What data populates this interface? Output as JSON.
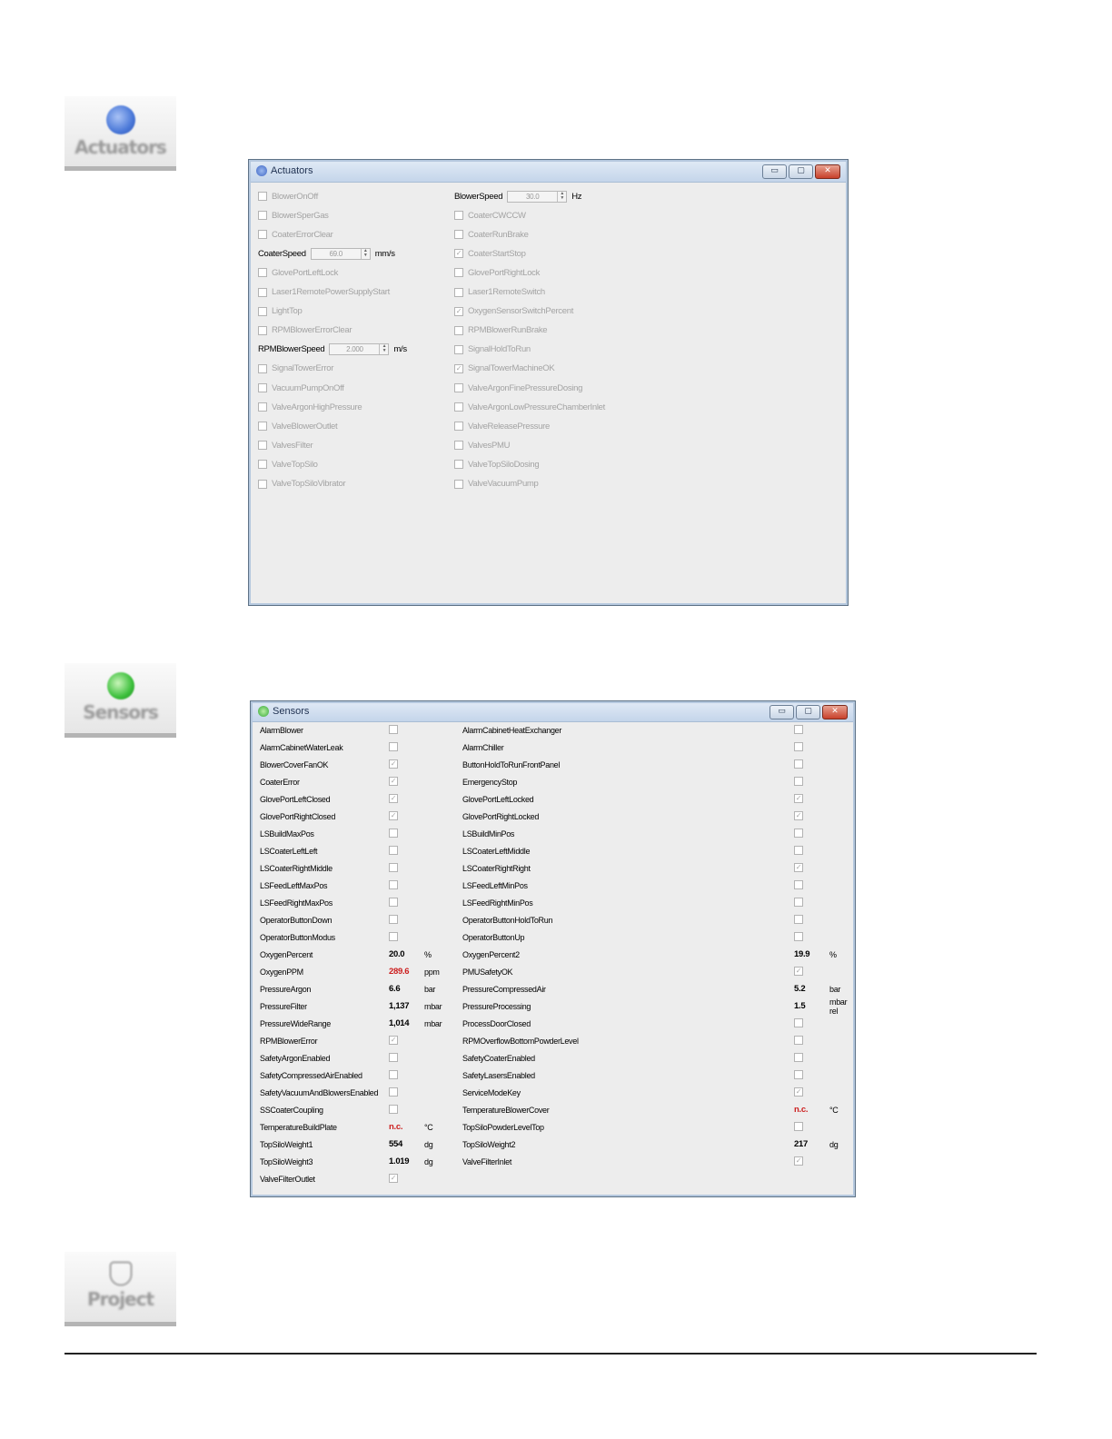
{
  "buttons": {
    "actuators": {
      "label": "Actuators",
      "icon": "gear-blue-icon",
      "color": "#4a78d8"
    },
    "sensors": {
      "label": "Sensors",
      "icon": "sensor-green-icon",
      "color": "#3cbf3c"
    },
    "project": {
      "label": "Project",
      "icon": "shield-outline-icon"
    }
  },
  "actuators_window": {
    "title": "Actuators",
    "left": [
      {
        "type": "check",
        "label": "BlowerOnOff",
        "checked": false
      },
      {
        "type": "check",
        "label": "BlowerSperGas",
        "checked": false
      },
      {
        "type": "check",
        "label": "CoaterErrorClear",
        "checked": false
      },
      {
        "type": "spin",
        "label": "CoaterSpeed",
        "value": "69.0",
        "unit": "mm/s"
      },
      {
        "type": "check",
        "label": "GlovePortLeftLock",
        "checked": false
      },
      {
        "type": "check",
        "label": "Laser1RemotePowerSupplyStart",
        "checked": false
      },
      {
        "type": "check",
        "label": "LightTop",
        "checked": false
      },
      {
        "type": "check",
        "label": "RPMBlowerErrorClear",
        "checked": false
      },
      {
        "type": "spin",
        "label": "RPMBlowerSpeed",
        "value": "2.000",
        "unit": "m/s"
      },
      {
        "type": "check",
        "label": "SignalTowerError",
        "checked": false
      },
      {
        "type": "check",
        "label": "VacuumPumpOnOff",
        "checked": false
      },
      {
        "type": "check",
        "label": "ValveArgonHighPressure",
        "checked": false
      },
      {
        "type": "check",
        "label": "ValveBlowerOutlet",
        "checked": false
      },
      {
        "type": "check",
        "label": "ValvesFilter",
        "checked": false
      },
      {
        "type": "check",
        "label": "ValveTopSilo",
        "checked": false
      },
      {
        "type": "check",
        "label": "ValveTopSiloVibrator",
        "checked": false
      }
    ],
    "right": [
      {
        "type": "spin",
        "label": "BlowerSpeed",
        "value": "30.0",
        "unit": "Hz"
      },
      {
        "type": "check",
        "label": "CoaterCWCCW",
        "checked": false
      },
      {
        "type": "check",
        "label": "CoaterRunBrake",
        "checked": false
      },
      {
        "type": "check",
        "label": "CoaterStartStop",
        "checked": true
      },
      {
        "type": "check",
        "label": "GlovePortRightLock",
        "checked": false
      },
      {
        "type": "check",
        "label": "Laser1RemoteSwitch",
        "checked": false
      },
      {
        "type": "check",
        "label": "OxygenSensorSwitchPercent",
        "checked": true
      },
      {
        "type": "check",
        "label": "RPMBlowerRunBrake",
        "checked": false
      },
      {
        "type": "check",
        "label": "SignalHoldToRun",
        "checked": false
      },
      {
        "type": "check",
        "label": "SignalTowerMachineOK",
        "checked": true
      },
      {
        "type": "check",
        "label": "ValveArgonFinePressureDosing",
        "checked": false
      },
      {
        "type": "check",
        "label": "ValveArgonLowPressureChamberInlet",
        "checked": false
      },
      {
        "type": "check",
        "label": "ValveReleasePressure",
        "checked": false
      },
      {
        "type": "check",
        "label": "ValvesPMU",
        "checked": false
      },
      {
        "type": "check",
        "label": "ValveTopSiloDosing",
        "checked": false
      },
      {
        "type": "check",
        "label": "ValveVacuumPump",
        "checked": false
      }
    ]
  },
  "sensors_window": {
    "title": "Sensors",
    "left": [
      {
        "label": "AlarmBlower",
        "type": "check",
        "checked": false
      },
      {
        "label": "AlarmCabinetWaterLeak",
        "type": "check",
        "checked": false
      },
      {
        "label": "BlowerCoverFanOK",
        "type": "check",
        "checked": true
      },
      {
        "label": "CoaterError",
        "type": "check",
        "checked": true
      },
      {
        "label": "GlovePortLeftClosed",
        "type": "check",
        "checked": true
      },
      {
        "label": "GlovePortRightClosed",
        "type": "check",
        "checked": true
      },
      {
        "label": "LSBuildMaxPos",
        "type": "check",
        "checked": false
      },
      {
        "label": "LSCoaterLeftLeft",
        "type": "check",
        "checked": false
      },
      {
        "label": "LSCoaterRightMiddle",
        "type": "check",
        "checked": false
      },
      {
        "label": "LSFeedLeftMaxPos",
        "type": "check",
        "checked": false
      },
      {
        "label": "LSFeedRightMaxPos",
        "type": "check",
        "checked": false
      },
      {
        "label": "OperatorButtonDown",
        "type": "check",
        "checked": false
      },
      {
        "label": "OperatorButtonModus",
        "type": "check",
        "checked": false
      },
      {
        "label": "OxygenPercent",
        "type": "value",
        "value": "20.0",
        "unit": "%"
      },
      {
        "label": "OxygenPPM",
        "type": "value",
        "value": "289.6",
        "unit": "ppm",
        "alert": true
      },
      {
        "label": "PressureArgon",
        "type": "value",
        "value": "6.6",
        "unit": "bar"
      },
      {
        "label": "PressureFilter",
        "type": "value",
        "value": "1,137",
        "unit": "mbar"
      },
      {
        "label": "PressureWideRange",
        "type": "value",
        "value": "1,014",
        "unit": "mbar"
      },
      {
        "label": "RPMBlowerError",
        "type": "check",
        "checked": true
      },
      {
        "label": "SafetyArgonEnabled",
        "type": "check",
        "checked": false
      },
      {
        "label": "SafetyCompressedAirEnabled",
        "type": "check",
        "checked": false
      },
      {
        "label": "SafetyVacuumAndBlowersEnabled",
        "type": "check",
        "checked": false
      },
      {
        "label": "SSCoaterCoupling",
        "type": "check",
        "checked": false
      },
      {
        "label": "TemperatureBuildPlate",
        "type": "value",
        "value": "n.c.",
        "unit": "°C",
        "alert": true
      },
      {
        "label": "TopSiloWeight1",
        "type": "value",
        "value": "554",
        "unit": "dg"
      },
      {
        "label": "TopSiloWeight3",
        "type": "value",
        "value": "1.019",
        "unit": "dg"
      },
      {
        "label": "ValveFilterOutlet",
        "type": "check",
        "checked": true
      }
    ],
    "right": [
      {
        "label": "AlarmCabinetHeatExchanger",
        "type": "check",
        "checked": false
      },
      {
        "label": "AlarmChiller",
        "type": "check",
        "checked": false
      },
      {
        "label": "ButtonHoldToRunFrontPanel",
        "type": "check",
        "checked": false
      },
      {
        "label": "EmergencyStop",
        "type": "check",
        "checked": false
      },
      {
        "label": "GlovePortLeftLocked",
        "type": "check",
        "checked": true
      },
      {
        "label": "GlovePortRightLocked",
        "type": "check",
        "checked": true
      },
      {
        "label": "LSBuildMinPos",
        "type": "check",
        "checked": false
      },
      {
        "label": "LSCoaterLeftMiddle",
        "type": "check",
        "checked": false
      },
      {
        "label": "LSCoaterRightRight",
        "type": "check",
        "checked": true
      },
      {
        "label": "LSFeedLeftMinPos",
        "type": "check",
        "checked": false
      },
      {
        "label": "LSFeedRightMinPos",
        "type": "check",
        "checked": false
      },
      {
        "label": "OperatorButtonHoldToRun",
        "type": "check",
        "checked": false
      },
      {
        "label": "OperatorButtonUp",
        "type": "check",
        "checked": false
      },
      {
        "label": "OxygenPercent2",
        "type": "value",
        "value": "19.9",
        "unit": "%"
      },
      {
        "label": "PMUSafetyOK",
        "type": "check",
        "checked": true
      },
      {
        "label": "PressureCompressedAir",
        "type": "value",
        "value": "5.2",
        "unit": "bar"
      },
      {
        "label": "PressureProcessing",
        "type": "value",
        "value": "1.5",
        "unit": "mbar rel"
      },
      {
        "label": "ProcessDoorClosed",
        "type": "check",
        "checked": false
      },
      {
        "label": "RPMOverflowBottomPowderLevel",
        "type": "check",
        "checked": false
      },
      {
        "label": "SafetyCoaterEnabled",
        "type": "check",
        "checked": false
      },
      {
        "label": "SafetyLasersEnabled",
        "type": "check",
        "checked": false
      },
      {
        "label": "ServiceModeKey",
        "type": "check",
        "checked": true
      },
      {
        "label": "TemperatureBlowerCover",
        "type": "value",
        "value": "n.c.",
        "unit": "°C",
        "alert": true
      },
      {
        "label": "TopSiloPowderLevelTop",
        "type": "check",
        "checked": false
      },
      {
        "label": "TopSiloWeight2",
        "type": "value",
        "value": "217",
        "unit": "dg"
      },
      {
        "label": "ValveFilterInlet",
        "type": "check",
        "checked": true
      }
    ]
  },
  "window_controls": {
    "minimize": "▭",
    "maximize": "▢",
    "close": "✕"
  },
  "colors": {
    "alert": "#cc1e1e",
    "titlebar": "#c4d5ea"
  }
}
